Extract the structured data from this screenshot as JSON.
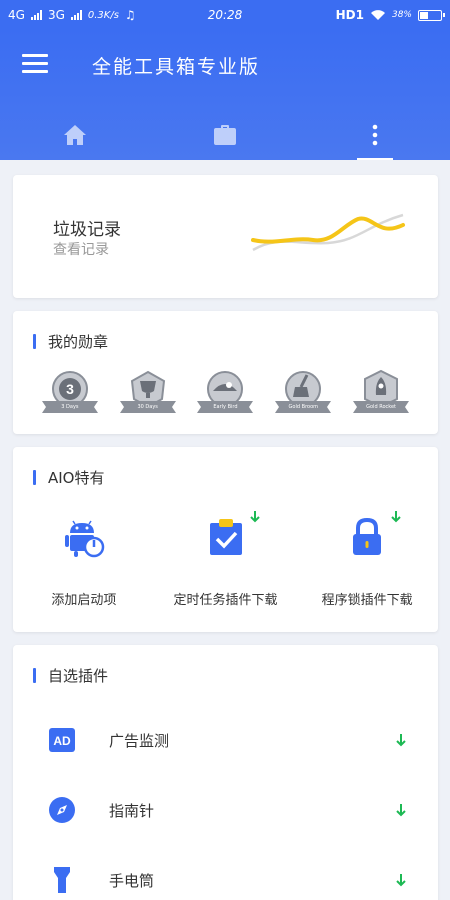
{
  "status_bar": {
    "network1": "4G",
    "network2": "3G",
    "speed": "0.3K/s",
    "time": "20:28",
    "hd": "HD1",
    "battery_pct": "38%",
    "battery_level": 0.38
  },
  "header": {
    "title": "全能工具箱专业版",
    "tabs": [
      {
        "name": "home",
        "icon": "home-icon",
        "active": false
      },
      {
        "name": "tools",
        "icon": "briefcase-icon",
        "active": false
      },
      {
        "name": "more",
        "icon": "more-vertical-icon",
        "active": true
      }
    ]
  },
  "history_card": {
    "title": "垃圾记录",
    "subtitle": "查看记录"
  },
  "badges_section": {
    "title": "我的勋章",
    "badges": [
      {
        "icon": "badge-3days-icon",
        "text": "3 Days"
      },
      {
        "icon": "badge-30days-icon",
        "text": "30 Days"
      },
      {
        "icon": "badge-early-bird-icon",
        "text": "Early Bird"
      },
      {
        "icon": "badge-gold-broom-icon",
        "text": "Gold Broom"
      },
      {
        "icon": "badge-gold-rocket-icon",
        "text": "Gold Rocket"
      }
    ]
  },
  "aio_section": {
    "title": "AIO特有",
    "items": [
      {
        "label": "添加启动项",
        "icon": "android-power-icon",
        "download": false
      },
      {
        "label": "定时任务插件下载",
        "icon": "clipboard-check-icon",
        "download": true
      },
      {
        "label": "程序锁插件下载",
        "icon": "lock-icon",
        "download": true
      }
    ]
  },
  "plugins_section": {
    "title": "自选插件",
    "items": [
      {
        "label": "广告监测",
        "icon": "ad-icon"
      },
      {
        "label": "指南针",
        "icon": "compass-icon"
      },
      {
        "label": "手电筒",
        "icon": "flashlight-icon"
      }
    ]
  },
  "colors": {
    "primary": "#3b6df2",
    "download_green": "#1db954",
    "chart_yellow": "#f5c518",
    "badge_gray": "#8a8f98"
  }
}
